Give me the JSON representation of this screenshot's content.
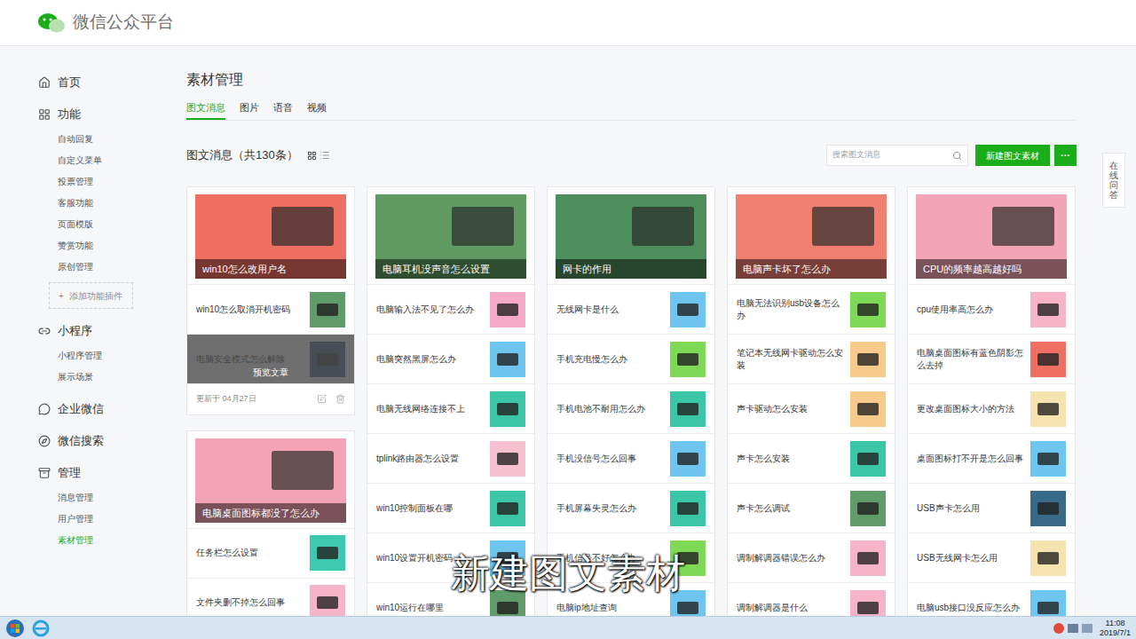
{
  "header": {
    "logo_text": "微信公众平台"
  },
  "sidebar": [
    {
      "label": "首页",
      "items": []
    },
    {
      "label": "功能",
      "items": [
        {
          "label": "自动回复",
          "selected": false
        },
        {
          "label": "自定义菜单",
          "selected": false
        },
        {
          "label": "投票管理",
          "selected": false
        },
        {
          "label": "客服功能",
          "selected": false
        },
        {
          "label": "页面模版",
          "selected": false
        },
        {
          "label": "赞赏功能",
          "selected": false
        },
        {
          "label": "原创管理",
          "selected": false
        }
      ],
      "add_plugin": {
        "icon": "+",
        "label": "添加功能插件"
      }
    },
    {
      "label": "小程序",
      "items": [
        {
          "label": "小程序管理",
          "selected": false
        },
        {
          "label": "展示场景",
          "selected": false
        }
      ]
    },
    {
      "label": "企业微信",
      "items": []
    },
    {
      "label": "微信搜索",
      "items": []
    },
    {
      "label": "管理",
      "items": [
        {
          "label": "消息管理",
          "selected": false
        },
        {
          "label": "用户管理",
          "selected": false
        },
        {
          "label": "素材管理",
          "selected": true
        }
      ]
    }
  ],
  "page_title": "素材管理",
  "tabs": [
    {
      "label": "图文消息",
      "selected": true
    },
    {
      "label": "图片",
      "selected": false
    },
    {
      "label": "语音",
      "selected": false
    },
    {
      "label": "视频",
      "selected": false
    }
  ],
  "list_header": "图文消息（共130条）",
  "view_modes": [
    {
      "kind": "grid",
      "selected": true
    },
    {
      "kind": "list",
      "selected": false
    }
  ],
  "search": {
    "placeholder": "搜索图文消息"
  },
  "buttons": {
    "create": "新建图文素材",
    "more": "···"
  },
  "float_help": "在线问答",
  "columns": [
    {
      "cards": [
        {
          "cover": {
            "title": "win10怎么改用户名",
            "color": "#ef6f63"
          },
          "items": [
            {
              "title": "win10怎么取消开机密码",
              "color": "#5f9c6a",
              "hovered": false
            },
            {
              "title": "电脑安全模式怎么解除",
              "color": "#3a5a8a",
              "hovered": true,
              "overlay": "预览文章"
            }
          ],
          "footer": {
            "updated": "更新于 04月27日"
          }
        },
        {
          "cover": {
            "title": "电脑桌面图标都没了怎么办",
            "color": "#f4a3b6"
          },
          "items": [
            {
              "title": "任务栏怎么设置",
              "color": "#3cc9b0",
              "hovered": false
            },
            {
              "title": "文件夹删不掉怎么回事",
              "color": "#f7b3c8",
              "hovered": false
            }
          ]
        }
      ]
    },
    {
      "cards": [
        {
          "cover": {
            "title": "电脑耳机没声音怎么设置",
            "color": "#5f9a62"
          },
          "items": [
            {
              "title": "电脑输入法不见了怎么办",
              "color": "#f5a9c6",
              "hovered": false
            },
            {
              "title": "电脑突然黑屏怎么办",
              "color": "#6ec6f0",
              "hovered": false
            },
            {
              "title": "电脑无线网络连接不上",
              "color": "#3cc6a8",
              "hovered": false
            },
            {
              "title": "tplink路由器怎么设置",
              "color": "#f7c1d2",
              "hovered": false
            },
            {
              "title": "win10控制面板在哪",
              "color": "#3cc6a8",
              "hovered": false
            },
            {
              "title": "win10设置开机密码",
              "color": "#6ec6f0",
              "hovered": false
            },
            {
              "title": "win10运行在哪里",
              "color": "#5f9c6a",
              "hovered": false
            }
          ]
        }
      ]
    },
    {
      "cards": [
        {
          "cover": {
            "title": "网卡的作用",
            "color": "#4d8f5c"
          },
          "items": [
            {
              "title": "无线网卡是什么",
              "color": "#6ec6f0",
              "hovered": false
            },
            {
              "title": "手机充电慢怎么办",
              "color": "#7ed957",
              "hovered": false
            },
            {
              "title": "手机电池不耐用怎么办",
              "color": "#3cc6a8",
              "hovered": false
            },
            {
              "title": "手机没信号怎么回事",
              "color": "#6ec6f0",
              "hovered": false
            },
            {
              "title": "手机屏幕失灵怎么办",
              "color": "#3cc6a8",
              "hovered": false
            },
            {
              "title": "手机信号不好怎么办",
              "color": "#7ed957",
              "hovered": false
            },
            {
              "title": "电脑ip地址查询",
              "color": "#6ec6f0",
              "hovered": false
            }
          ]
        }
      ]
    },
    {
      "cards": [
        {
          "cover": {
            "title": "电脑声卡坏了怎么办",
            "color": "#f07f70"
          },
          "items": [
            {
              "title": "电脑无法识别usb设备怎么办",
              "color": "#7ed957",
              "hovered": false
            },
            {
              "title": "笔记本无线网卡驱动怎么安装",
              "color": "#f7c98a",
              "hovered": false
            },
            {
              "title": "声卡驱动怎么安装",
              "color": "#f7c98a",
              "hovered": false
            },
            {
              "title": "声卡怎么安装",
              "color": "#3cc6a8",
              "hovered": false
            },
            {
              "title": "声卡怎么调试",
              "color": "#5f9c6a",
              "hovered": false
            },
            {
              "title": "调制解调器错误怎么办",
              "color": "#f7b3c8",
              "hovered": false
            },
            {
              "title": "调制解调器是什么",
              "color": "#f7b3c8",
              "hovered": false
            }
          ]
        }
      ]
    },
    {
      "cards": [
        {
          "cover": {
            "title": "CPU的频率越高越好吗",
            "color": "#f4a5b5"
          },
          "items": [
            {
              "title": "cpu使用率高怎么办",
              "color": "#f7b3c8",
              "hovered": false
            },
            {
              "title": "电脑桌面图标有蓝色阴影怎么去掉",
              "color": "#ef6f63",
              "hovered": false
            },
            {
              "title": "更改桌面图标大小的方法",
              "color": "#f7e3b0",
              "hovered": false
            },
            {
              "title": "桌面图标打不开是怎么回事",
              "color": "#6ec6f0",
              "hovered": false
            },
            {
              "title": "USB声卡怎么用",
              "color": "#3a6a8a",
              "hovered": false
            },
            {
              "title": "USB无线网卡怎么用",
              "color": "#f7e3b0",
              "hovered": false
            },
            {
              "title": "电脑usb接口没反应怎么办",
              "color": "#6ec6f0",
              "hovered": false
            }
          ]
        }
      ]
    }
  ],
  "subtitle": "新建图文素材",
  "taskbar": {
    "time": "11:08",
    "date": "2019/7/1"
  }
}
